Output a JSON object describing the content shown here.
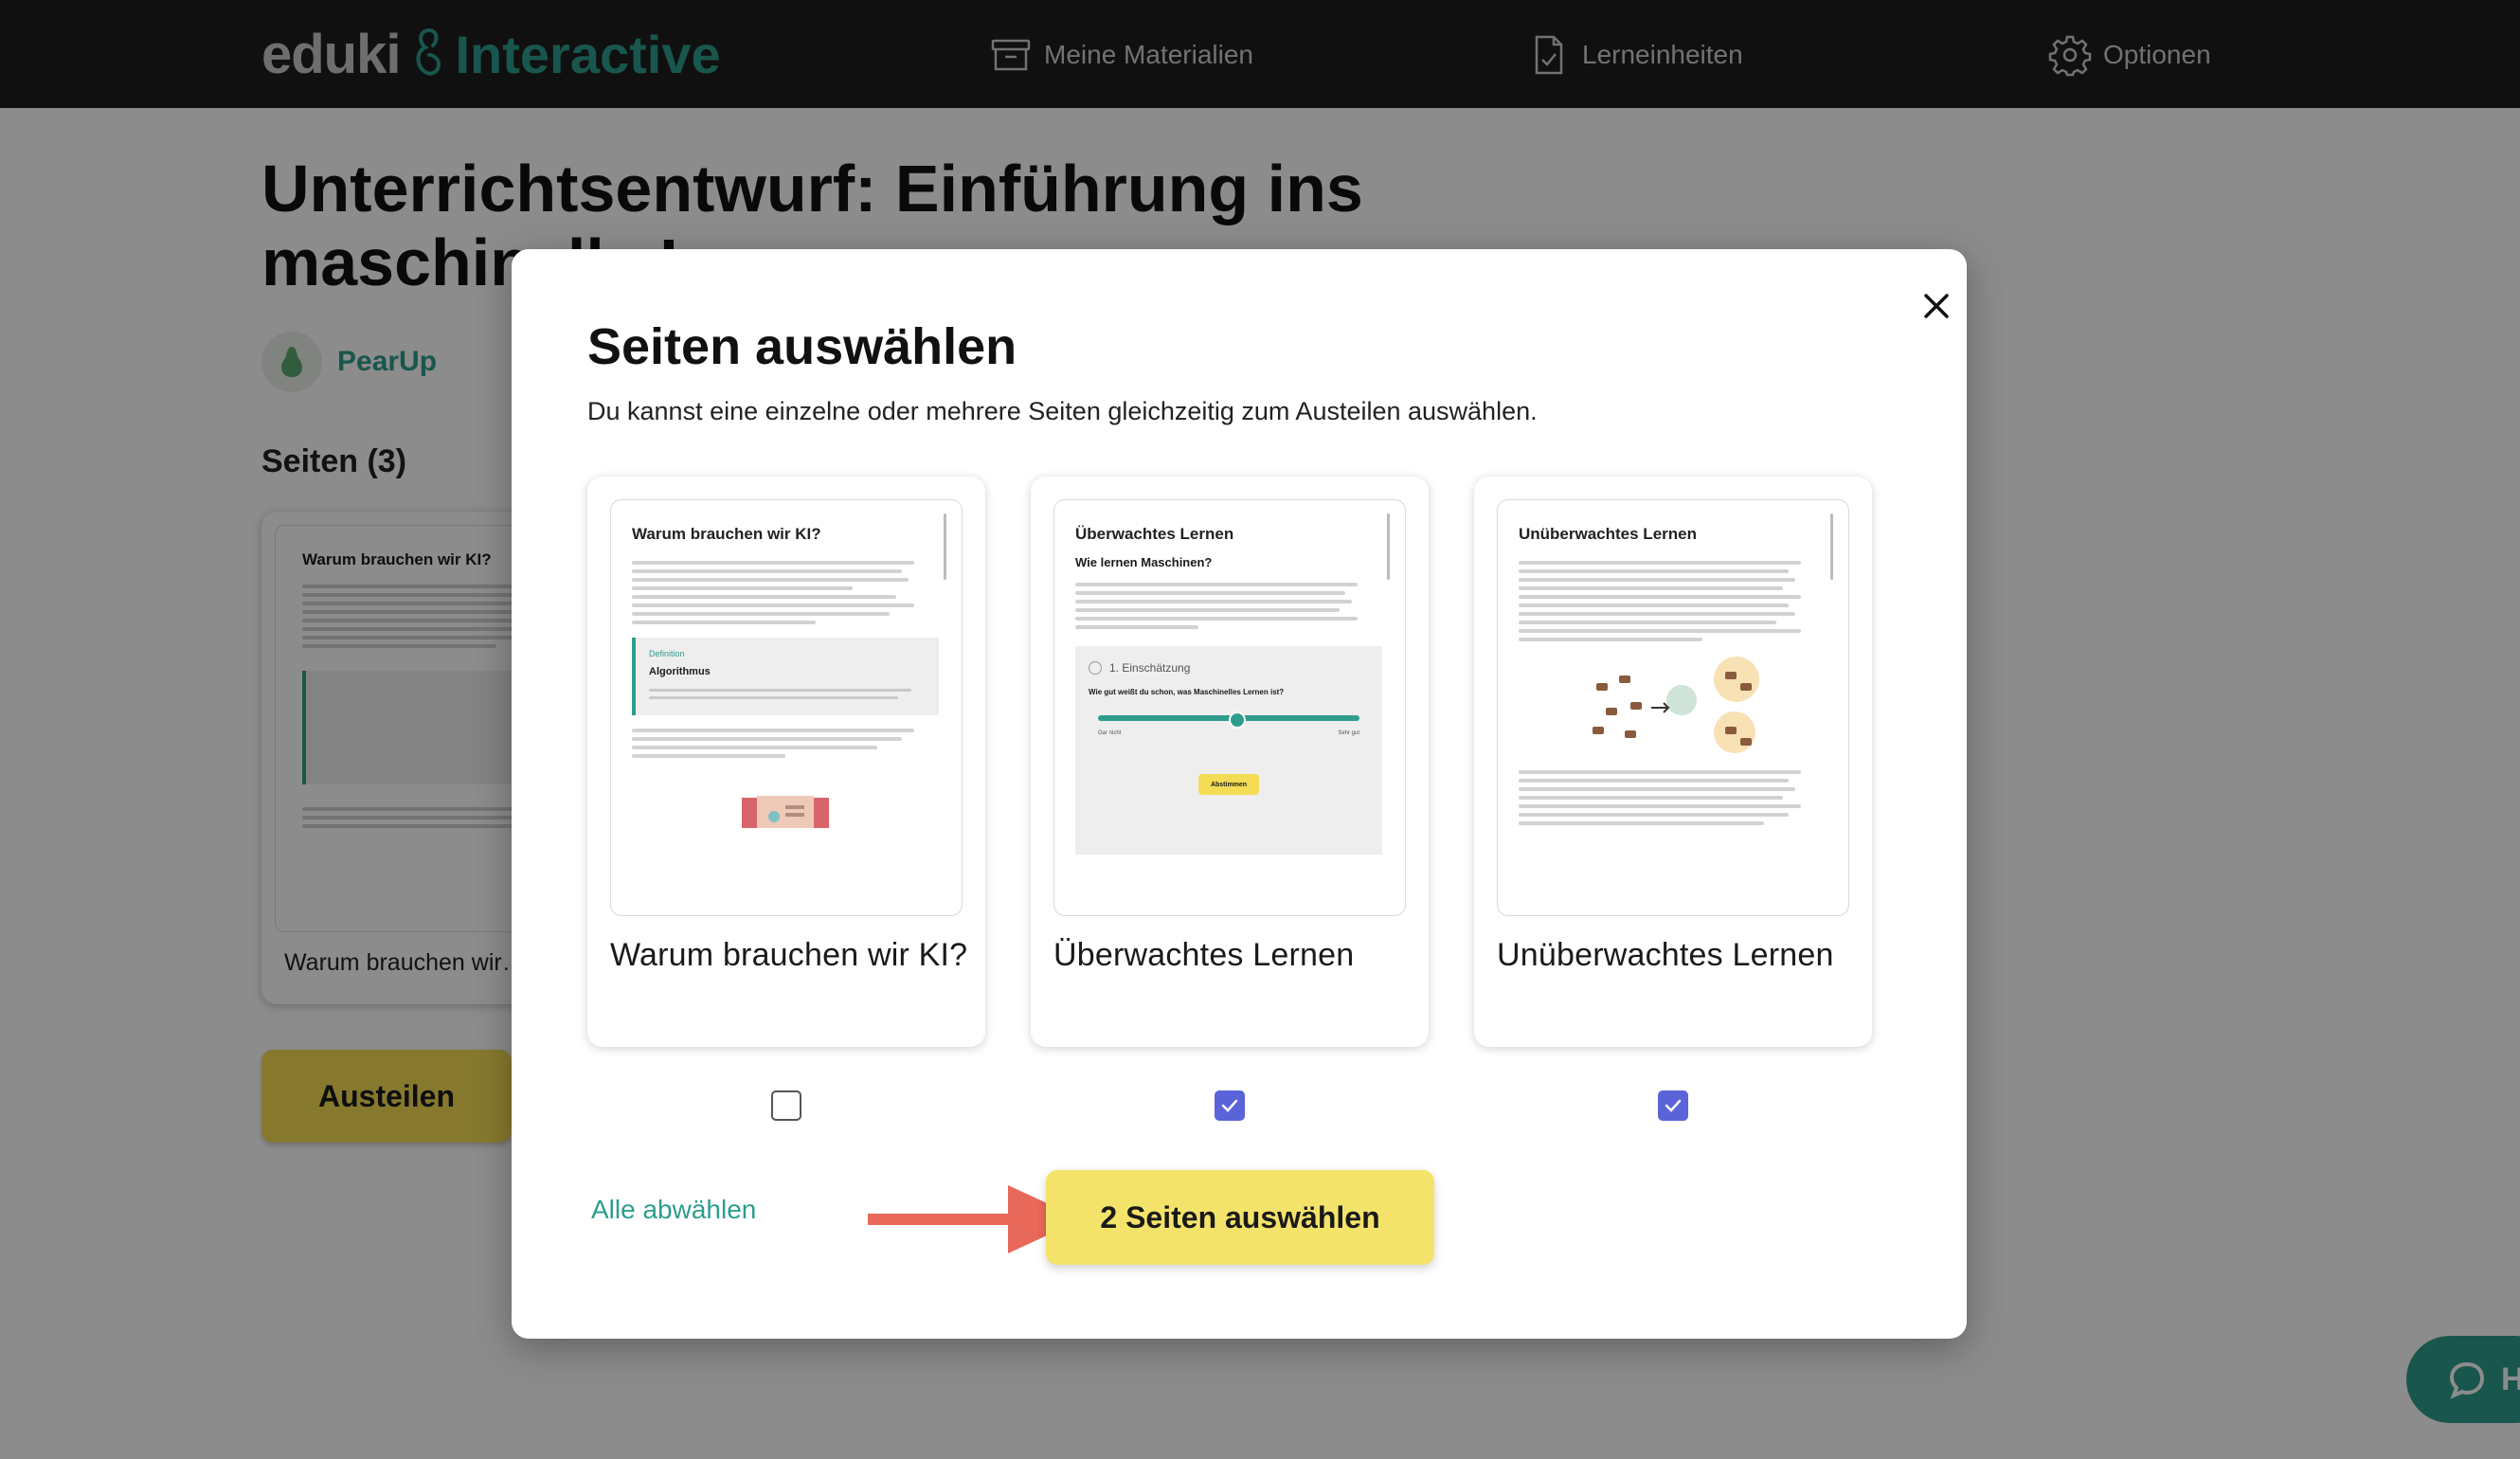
{
  "header": {
    "logo_word": "eduki",
    "logo_product": "Interactive",
    "nav": [
      {
        "label": "Meine Materialien",
        "icon": "archive-box-icon"
      },
      {
        "label": "Lerneinheiten",
        "icon": "document-check-icon"
      },
      {
        "label": "Optionen",
        "icon": "gear-icon"
      }
    ]
  },
  "background_page": {
    "title": "Unterrichtsentwurf: Einführung ins maschinelle Lernen",
    "author": "PearUp",
    "pages_heading": "Seiten (3)",
    "card_caption": "Warum brauchen wir…",
    "card_thumb_title": "Warum brauchen wir KI?",
    "share_button": "Austeilen",
    "help_label": "H"
  },
  "modal": {
    "title": "Seiten auswählen",
    "description": "Du kannst eine einzelne oder mehrere Seiten gleichzeitig zum Austeilen auswählen.",
    "pages": [
      {
        "title": "Warum brauchen wir KI?",
        "thumb_title": "Warum brauchen wir KI?",
        "definition_label": "Definition",
        "definition_title": "Algorithmus",
        "checked": false
      },
      {
        "title": "Überwachtes Lernen",
        "thumb_title": "Überwachtes Lernen",
        "thumb_subtitle": "Wie lernen Maschinen?",
        "quiz_heading": "1. Einschätzung",
        "quiz_question": "Wie gut weißt du schon, was Maschinelles Lernen ist?",
        "slider_left": "Gar nicht",
        "slider_right": "Sehr gut",
        "vote_button": "Abstimmen",
        "checked": true
      },
      {
        "title": "Unüberwachtes Lernen",
        "thumb_title": "Unüberwachtes Lernen",
        "checked": true
      }
    ],
    "deselect_all": "Alle abwählen",
    "confirm_button": "2 Seiten auswählen"
  },
  "colors": {
    "accent_teal": "#2e9d8d",
    "button_yellow": "#f4e36a",
    "checkbox_blue": "#5b63d9",
    "arrow_red": "#e8685a"
  }
}
